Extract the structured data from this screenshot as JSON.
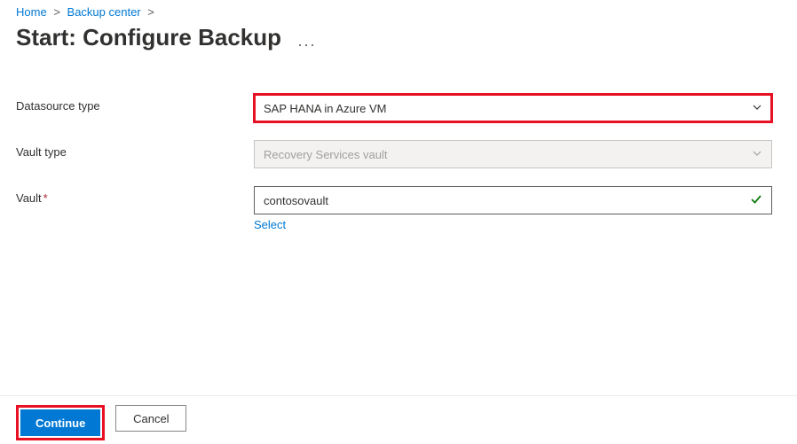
{
  "breadcrumb": {
    "home": "Home",
    "backup_center": "Backup center"
  },
  "page": {
    "title": "Start: Configure Backup",
    "more": "..."
  },
  "form": {
    "datasource_type": {
      "label": "Datasource type",
      "value": "SAP HANA in Azure VM"
    },
    "vault_type": {
      "label": "Vault type",
      "value": "Recovery Services vault"
    },
    "vault": {
      "label": "Vault",
      "value": "contosovault",
      "select_link": "Select"
    }
  },
  "footer": {
    "continue": "Continue",
    "cancel": "Cancel"
  }
}
